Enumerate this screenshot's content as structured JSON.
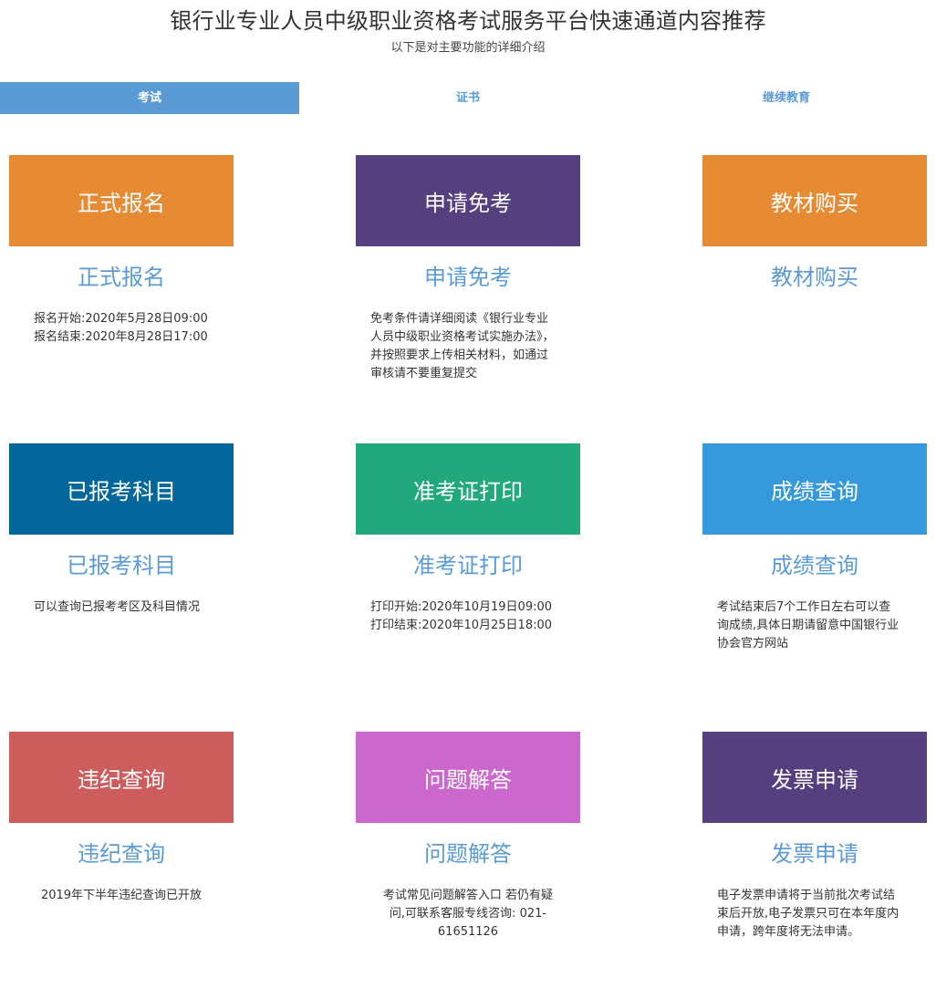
{
  "header": {
    "title": "银行业专业人员中级职业资格考试服务平台快速通道内容推荐",
    "subtitle": "以下是对主要功能的详细介绍"
  },
  "tabs": [
    {
      "label": "考试",
      "active": true
    },
    {
      "label": "证书",
      "active": false
    },
    {
      "label": "继续教育",
      "active": false
    }
  ],
  "colors": {
    "accent": "#5b9bd5",
    "orange": "#e68a33",
    "purple": "#553f7e",
    "navy": "#04679b",
    "green": "#21a97d",
    "sky": "#3599dc",
    "red": "#cd5d5d",
    "magenta": "#cb67cd"
  },
  "cards": [
    {
      "tile_label": "正式报名",
      "title": "正式报名",
      "description": "报名开始:2020年5月28日09:00\n报名结束:2020年8月28日17:00"
    },
    {
      "tile_label": "申请免考",
      "title": "申请免考",
      "description": "免考条件请详细阅读《银行业专业\n人员中级职业资格考试实施办法》，\n并按照要求上传相关材料，如通过\n审核请不要重复提交"
    },
    {
      "tile_label": "教材购买",
      "title": "教材购买",
      "description": ""
    },
    {
      "tile_label": "已报考科目",
      "title": "已报考科目",
      "description": "可以查询已报考考区及科目情况"
    },
    {
      "tile_label": "准考证打印",
      "title": "准考证打印",
      "description": "打印开始:2020年10月19日09:00\n打印结束:2020年10月25日18:00"
    },
    {
      "tile_label": "成绩查询",
      "title": "成绩查询",
      "description": "考试结束后7个工作日左右可以查\n询成绩,具体日期请留意中国银行业\n协会官方网站"
    },
    {
      "tile_label": "违纪查询",
      "title": "违纪查询",
      "description": "2019年下半年违纪查询已开放"
    },
    {
      "tile_label": "问题解答",
      "title": "问题解答",
      "description": "考试常见问题解答入口 若仍有疑\n问,可联系客服专线咨询: 021-\n61651126"
    },
    {
      "tile_label": "发票申请",
      "title": "发票申请",
      "description": "电子发票申请将于当前批次考试结\n束后开放,电子发票只可在本年度内\n申请，跨年度将无法申请。"
    }
  ]
}
